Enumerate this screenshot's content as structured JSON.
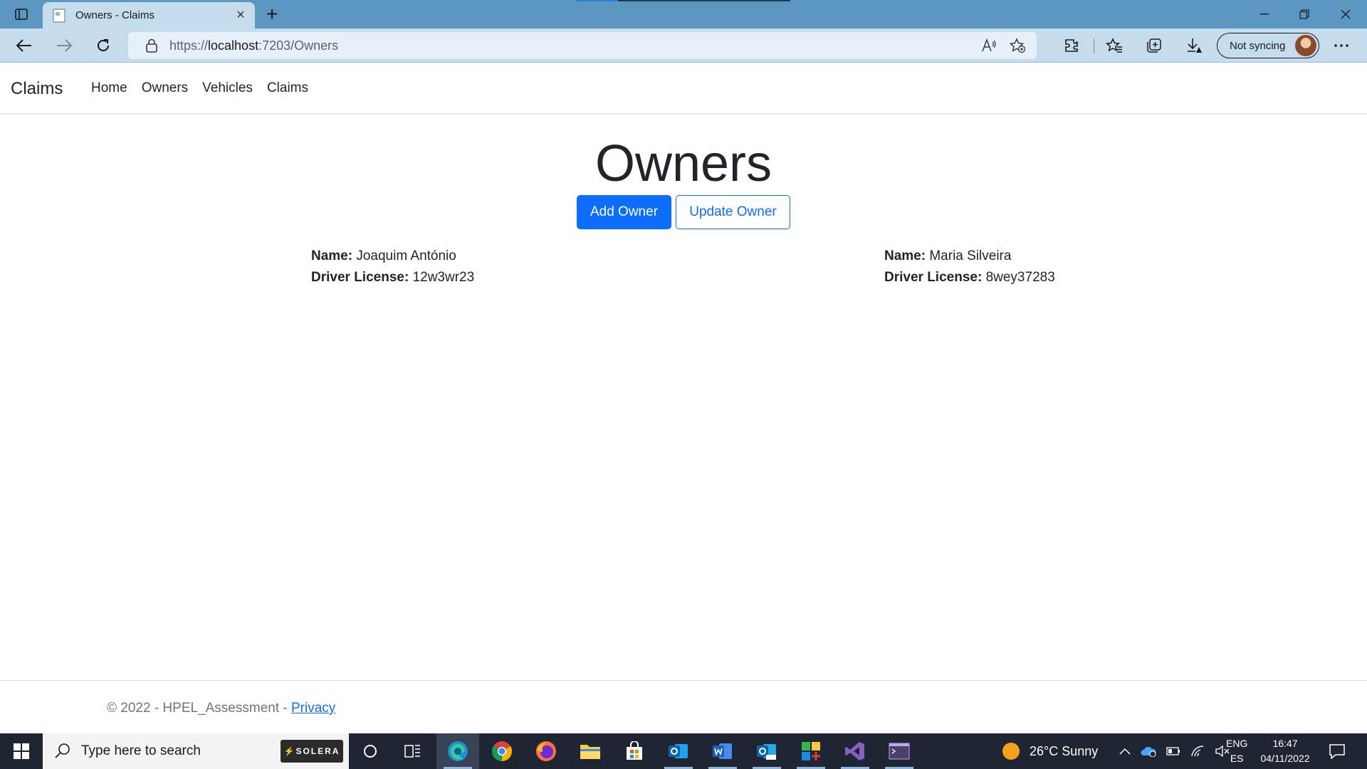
{
  "browser": {
    "tab_title": "Owners - Claims",
    "url_scheme": "https://",
    "url_host": "localhost",
    "url_rest": ":7203/Owners",
    "profile_label": "Not syncing"
  },
  "navbar": {
    "brand": "Claims",
    "links": [
      "Home",
      "Owners",
      "Vehicles",
      "Claims"
    ]
  },
  "main": {
    "title": "Owners",
    "add_button": "Add Owner",
    "update_button": "Update Owner",
    "name_label": "Name:",
    "license_label": "Driver License:",
    "owners": [
      {
        "name": "Joaquim António",
        "license": "12w3wr23"
      },
      {
        "name": "Maria Silveira",
        "license": "8wey37283"
      }
    ]
  },
  "footer": {
    "text": "© 2022 - HPEL_Assessment - ",
    "privacy_link": "Privacy"
  },
  "taskbar": {
    "search_placeholder": "Type here to search",
    "search_brand": "SOLERA",
    "weather": "26°C  Sunny",
    "lang_top": "ENG",
    "lang_bottom": "ES",
    "time": "16:47",
    "date": "04/11/2022"
  },
  "colors": {
    "primary": "#0d6efd",
    "tabstrip": "#5b97c1",
    "toolbar": "#c5dcec",
    "taskbar": "#202534"
  }
}
